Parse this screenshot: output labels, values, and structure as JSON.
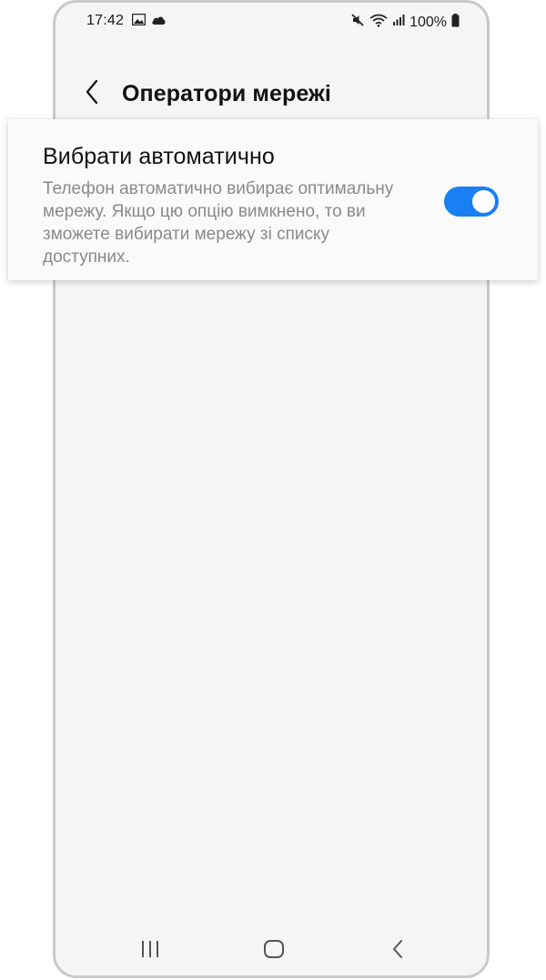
{
  "status_bar": {
    "time": "17:42",
    "battery": "100%",
    "left_icons": [
      "gallery-icon",
      "cloud-icon"
    ],
    "right_icons": [
      "mute-icon",
      "wifi-icon",
      "signal-icon",
      "battery-icon"
    ]
  },
  "app_bar": {
    "title": "Оператори мережі",
    "back_icon": "chevron-left-icon"
  },
  "setting": {
    "title": "Вибрати автоматично",
    "description": "Телефон автоматично вибирає оптимальну мережу. Якщо цю опцію вимкнено, то ви зможете вибирати мережу зі списку доступних.",
    "toggle_on": true,
    "accent_color": "#1a7ff2"
  },
  "nav_bar": {
    "buttons": [
      "recent-apps-icon",
      "home-icon",
      "back-icon"
    ]
  }
}
